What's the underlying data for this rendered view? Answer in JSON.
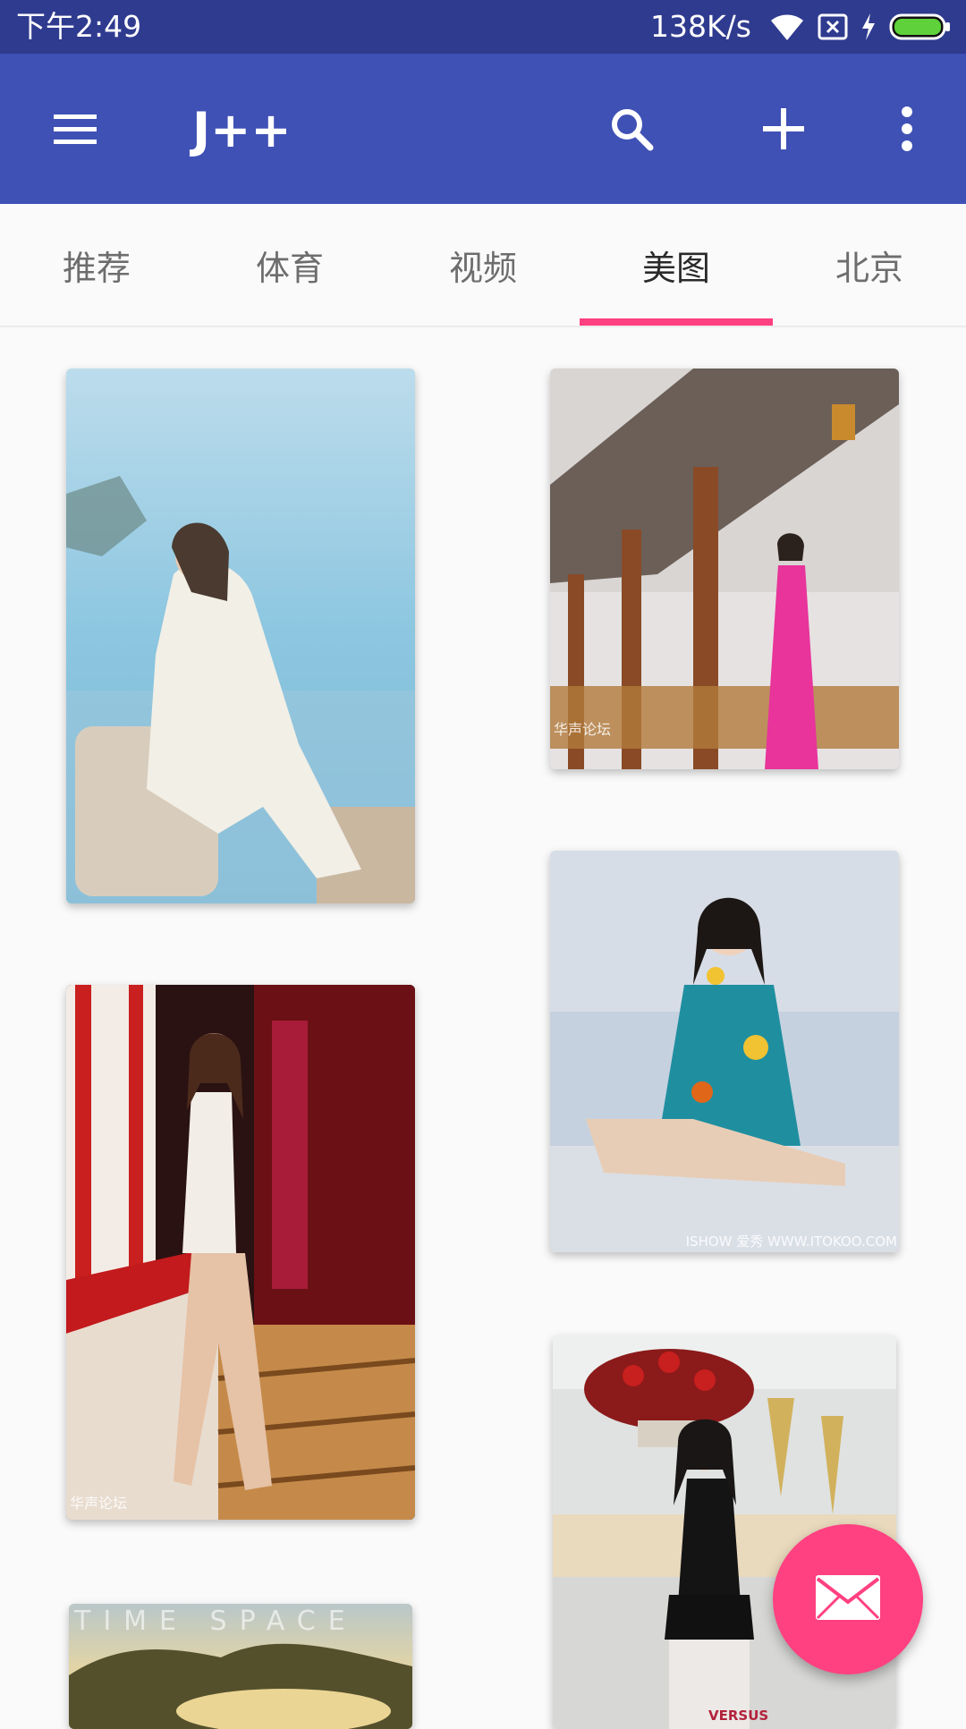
{
  "status_bar": {
    "time": "下午2:49",
    "net_speed": "138K/s",
    "icons": [
      "wifi-icon",
      "no-sim-icon",
      "charging-icon",
      "battery-icon"
    ]
  },
  "app_bar": {
    "title": "J++",
    "icons": [
      "menu-icon",
      "search-icon",
      "add-icon",
      "more-vert-icon"
    ],
    "color": "#3f51b5"
  },
  "tabs": {
    "items": [
      {
        "label": "推荐"
      },
      {
        "label": "体育"
      },
      {
        "label": "视频"
      },
      {
        "label": "美图"
      },
      {
        "label": "北京"
      }
    ],
    "selected": "美图",
    "indicator_color": "#ff4081"
  },
  "gallery": {
    "watermarks": {
      "card_2": "华声论坛",
      "card_3": "ISHOW 爱秀 WWW.ITOKOO.COM",
      "card_4": "华声论坛",
      "card_5": "VERSUS",
      "card_6": "TIME SPACE"
    }
  },
  "fab": {
    "icon": "mail-icon",
    "color": "#ff4081"
  }
}
